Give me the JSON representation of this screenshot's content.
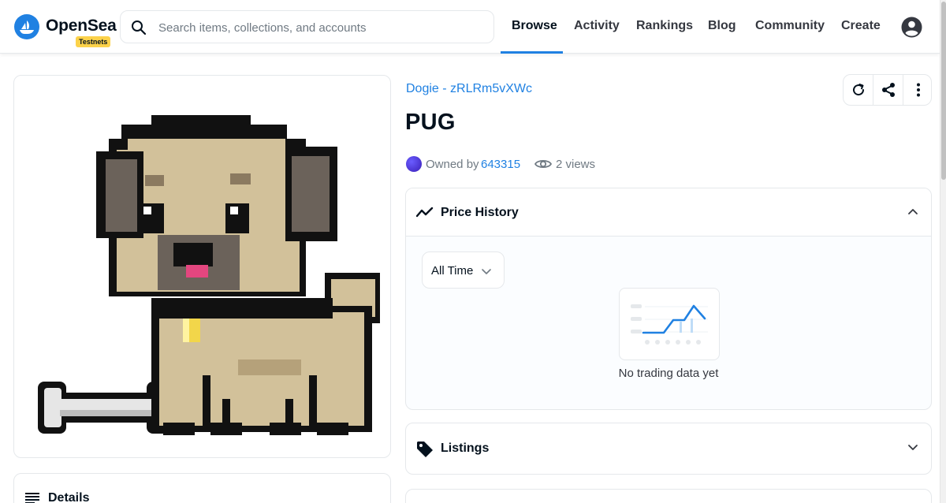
{
  "header": {
    "brand": "OpenSea",
    "badge": "Testnets",
    "search_placeholder": "Search items, collections, and accounts",
    "nav": [
      {
        "label": "Browse",
        "active": true
      },
      {
        "label": "Activity"
      },
      {
        "label": "Rankings"
      },
      {
        "label": "Blog"
      },
      {
        "label": "Community"
      },
      {
        "label": "Create"
      }
    ],
    "account_icon": "account-circle-icon"
  },
  "item": {
    "collection": "Dogie - zRLRm5vXWc",
    "name": "PUG",
    "owned_by_label": "Owned by",
    "owner": "643315",
    "views": "2 views"
  },
  "actions": [
    "refresh-icon",
    "share-icon",
    "more-vertical-icon"
  ],
  "price_history": {
    "title": "Price History",
    "time_filter": "All Time",
    "empty_text": "No trading data yet"
  },
  "listings": {
    "title": "Listings"
  },
  "details": {
    "title": "Details"
  },
  "colors": {
    "accent": "#2081e2",
    "badge": "#fcd24a",
    "border": "#e5e8eb",
    "muted": "#707a83"
  }
}
